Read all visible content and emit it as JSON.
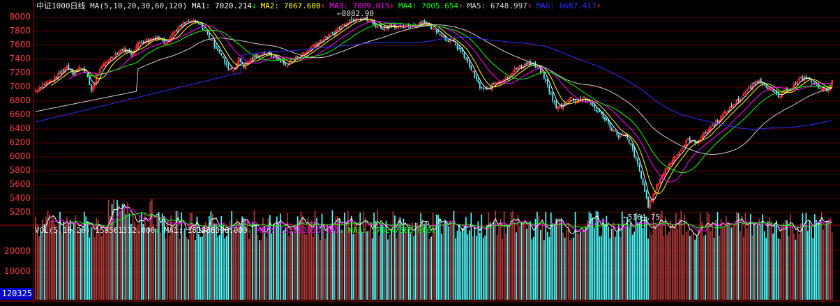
{
  "chart_data": {
    "type": "candlestick",
    "title": "中证1000日线",
    "main_header": {
      "name": "中证1000",
      "period": "日线",
      "indicator": "MA(5,10,20,30,60,120)",
      "ma": [
        {
          "label": "MA1:",
          "value": "7020.214",
          "arrow": "↓",
          "color": "#ffffff"
        },
        {
          "label": "MA2:",
          "value": "7067.600",
          "arrow": "↑",
          "color": "#ffff00"
        },
        {
          "label": "MA3:",
          "value": "7009.815",
          "arrow": "↑",
          "color": "#ff00ff"
        },
        {
          "label": "MA4:",
          "value": "7005.654",
          "arrow": "↑",
          "color": "#00ff00"
        },
        {
          "label": "MA5:",
          "value": "6748.997",
          "arrow": "↑",
          "color": "#d0d0d0"
        },
        {
          "label": "MA6:",
          "value": "6687.417",
          "arrow": "↑",
          "color": "#3030ff"
        }
      ]
    },
    "y_ticks": [
      "8000",
      "7800",
      "7600",
      "7400",
      "7200",
      "7000",
      "6800",
      "6600",
      "6400",
      "6200",
      "6000",
      "5800",
      "5600",
      "5400",
      "5200"
    ],
    "ylim": [
      5100,
      8100
    ],
    "annotations": {
      "high": "8082.90",
      "low": "5164.75"
    },
    "volume_header": {
      "indicator": "VOL(5,10,20)",
      "value": "158561312.000",
      "value_arrow": "↓",
      "ma": [
        {
          "label": "MA1:",
          "value": "181888096.000",
          "arrow": "↓",
          "color": "#ffffff"
        },
        {
          "label": "MA2:",
          "value": "172892656.000",
          "arrow": "↓",
          "color": "#ff00ff"
        },
        {
          "label": "MA3:",
          "value": "176247808.000",
          "arrow": "↓",
          "color": "#00ff00"
        }
      ]
    },
    "vol_ticks": [
      "20000",
      "10000"
    ],
    "vol_box": "120325",
    "close_path": [
      [
        0,
        6950
      ],
      [
        5,
        7050
      ],
      [
        10,
        7100
      ],
      [
        14,
        7200
      ],
      [
        18,
        7300
      ],
      [
        22,
        7200
      ],
      [
        26,
        7300
      ],
      [
        29,
        7200
      ],
      [
        32,
        6950
      ],
      [
        35,
        7150
      ],
      [
        40,
        7350
      ],
      [
        45,
        7450
      ],
      [
        50,
        7550
      ],
      [
        55,
        7480
      ],
      [
        60,
        7650
      ],
      [
        65,
        7680
      ],
      [
        70,
        7720
      ],
      [
        75,
        7650
      ],
      [
        80,
        7800
      ],
      [
        85,
        7900
      ],
      [
        90,
        7950
      ],
      [
        94,
        7900
      ],
      [
        98,
        7800
      ],
      [
        102,
        7650
      ],
      [
        106,
        7500
      ],
      [
        110,
        7300
      ],
      [
        114,
        7250
      ],
      [
        117,
        7400
      ],
      [
        120,
        7300
      ],
      [
        124,
        7400
      ],
      [
        128,
        7450
      ],
      [
        132,
        7500
      ],
      [
        136,
        7450
      ],
      [
        140,
        7400
      ],
      [
        144,
        7300
      ],
      [
        148,
        7400
      ],
      [
        152,
        7450
      ],
      [
        156,
        7500
      ],
      [
        160,
        7600
      ],
      [
        165,
        7680
      ],
      [
        170,
        7750
      ],
      [
        175,
        7850
      ],
      [
        180,
        7950
      ],
      [
        185,
        8000
      ],
      [
        190,
        7980
      ],
      [
        195,
        7900
      ],
      [
        200,
        7850
      ],
      [
        205,
        7900
      ],
      [
        210,
        7850
      ],
      [
        215,
        7870
      ],
      [
        220,
        7900
      ],
      [
        224,
        7950
      ],
      [
        228,
        7850
      ],
      [
        232,
        7800
      ],
      [
        236,
        7700
      ],
      [
        240,
        7650
      ],
      [
        244,
        7550
      ],
      [
        248,
        7400
      ],
      [
        252,
        7200
      ],
      [
        256,
        7000
      ],
      [
        260,
        6950
      ],
      [
        264,
        7050
      ],
      [
        268,
        7100
      ],
      [
        272,
        7150
      ],
      [
        276,
        7250
      ],
      [
        280,
        7300
      ],
      [
        284,
        7350
      ],
      [
        288,
        7300
      ],
      [
        292,
        7200
      ],
      [
        296,
        6950
      ],
      [
        300,
        6700
      ],
      [
        304,
        6750
      ],
      [
        308,
        6850
      ],
      [
        312,
        6800
      ],
      [
        316,
        6850
      ],
      [
        320,
        6750
      ],
      [
        324,
        6650
      ],
      [
        328,
        6550
      ],
      [
        332,
        6400
      ],
      [
        336,
        6300
      ],
      [
        340,
        6300
      ],
      [
        344,
        6100
      ],
      [
        348,
        5800
      ],
      [
        351,
        5500
      ],
      [
        353,
        5300
      ],
      [
        356,
        5450
      ],
      [
        360,
        5700
      ],
      [
        364,
        5850
      ],
      [
        368,
        6000
      ],
      [
        372,
        6100
      ],
      [
        376,
        6250
      ],
      [
        380,
        6200
      ],
      [
        384,
        6300
      ],
      [
        388,
        6400
      ],
      [
        392,
        6500
      ],
      [
        396,
        6600
      ],
      [
        400,
        6700
      ],
      [
        404,
        6800
      ],
      [
        408,
        6900
      ],
      [
        412,
        7000
      ],
      [
        416,
        7100
      ],
      [
        420,
        7050
      ],
      [
        424,
        6950
      ],
      [
        428,
        6850
      ],
      [
        432,
        6950
      ],
      [
        436,
        7000
      ],
      [
        440,
        7100
      ],
      [
        444,
        7150
      ],
      [
        448,
        7050
      ],
      [
        452,
        7000
      ],
      [
        456,
        6950
      ],
      [
        459,
        7080
      ]
    ]
  }
}
